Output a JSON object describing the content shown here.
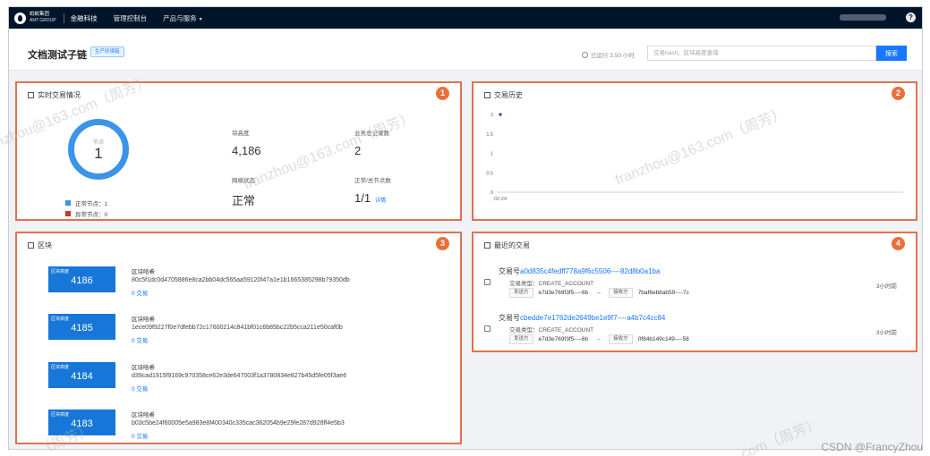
{
  "topbar": {
    "logo_line1": "蚂蚁集团",
    "logo_line2": "ANT GROUP",
    "brand": "金融科技",
    "nav": [
      "管理控制台",
      "产品与服务"
    ],
    "help_icon": "question-circle-icon"
  },
  "header": {
    "title": "文档测试子链",
    "env_tag": "生产环境链",
    "runtime": "已运行 3.50 小时",
    "search_placeholder": "交易hash、区块高度查询",
    "search_button": "搜索"
  },
  "realtime": {
    "title": "实时交易情况",
    "badge": "1",
    "donut_label": "节点",
    "donut_value": "1",
    "legend_normal": "正常节点：1",
    "legend_abnormal": "异常节点：0",
    "stats": {
      "height_label": "块高度",
      "height_value": "4,186",
      "records_label": "业务总记录数",
      "records_value": "2",
      "network_label": "网络状态",
      "network_value": "正常",
      "nodes_label": "正常/总节点数",
      "nodes_value": "1/1",
      "nodes_link": "详情"
    },
    "colors": {
      "normal": "#3a95e8",
      "abnormal": "#c0392b"
    }
  },
  "history": {
    "title": "交易历史",
    "badge": "2"
  },
  "chart_data": {
    "type": "scatter",
    "x": [
      "02-24"
    ],
    "y": [
      2
    ],
    "yticks": [
      "2",
      "1.5",
      "1",
      "0.5",
      "0"
    ],
    "xticks": [
      "02-24"
    ],
    "ylim": [
      0,
      2
    ],
    "grid": false
  },
  "blocks": {
    "title": "区块",
    "badge": "3",
    "height_caption": "区块高度",
    "hash_label": "区块哈希",
    "items": [
      {
        "height": "4186",
        "hash": "80c5f1dc0d4705886e8ca2bb04dc565aa59120f47a1e1b1665385298b79350db",
        "tx": "0 交易"
      },
      {
        "height": "4185",
        "hash": "1ece09f9227f0e7dfebb72c17600214c841bf01c6b85bc22b5cca211e50caf0b",
        "tx": "0 交易"
      },
      {
        "height": "4184",
        "hash": "d39cad1915f9169c970358ce62e3de647003f1a3780834e827b45d5fe05f3ae6",
        "tx": "0 交易"
      },
      {
        "height": "4183",
        "hash": "b03c5be24f60005e5a983e8f400340c335cac362054b9e29fe287d928ff4e5b3",
        "tx": "0 交易"
      }
    ]
  },
  "recent_tx": {
    "title": "最近的交易",
    "badge": "4",
    "items": [
      {
        "prefix": "交易号",
        "hash": "a0d835c4fedff778a9f6c5506----82d8b0a1ba",
        "type": "交易类型：CREATE_ACCOUNT",
        "from_tag": "发送方",
        "from": "e7d3e769f3f5----6b",
        "to_tag": "接收方",
        "to": "7baf6eb8ab59----7c",
        "time": "3小时前"
      },
      {
        "prefix": "交易号",
        "hash": "cbedde7e1762de2649be1e9f7----a4b7c4cc84",
        "type": "交易类型：CREATE_ACCOUNT",
        "from_tag": "发送方",
        "from": "e7d3e769f3f5----6b",
        "to_tag": "接收方",
        "to": "0f84b149c149----58",
        "time": "3小时前"
      }
    ]
  },
  "watermarks": {
    "w1": "franzhou@163.com（周芳）",
    "w2": "franzhou@163.com（周芳）",
    "w3": "franzhou@163.com（周芳）",
    "w4": ".com（周芳）",
    "w5": "（周芳）"
  },
  "credit": "CSDN @FrancyZhou"
}
